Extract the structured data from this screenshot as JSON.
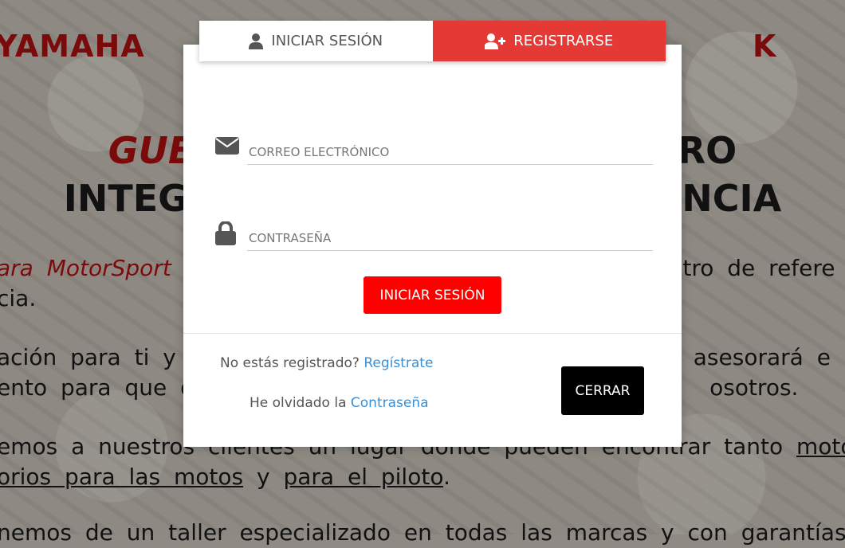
{
  "background": {
    "brands": {
      "yamaha": "YAMAHA",
      "k2": "K"
    },
    "hero": {
      "line1_red": "GUEV",
      "line1_end": "NTRO",
      "line2_start": "INTEGRA",
      "line2_end": "ALENCIA"
    },
    "paragraphs": {
      "p1_line1_red": "ara MotorSport",
      "p1_line1_end": "ntro de refere",
      "p1_line2": "cia.",
      "p2_line1_start": "ación para ti y",
      "p2_line1_end": "te asesorará e",
      "p2_line2_start": "ento para que dis",
      "p2_line2_end": "osotros.",
      "p3_line1_start": "emos a nuestros clientes un lugar donde pueden encontrar tanto",
      "p3_line1_link": "motos",
      "p3_line2_link1": "orios para las motos",
      "p3_line2_mid": "y",
      "p3_line2_link2": "para el piloto",
      "p3_line2_end": ".",
      "p4_line1": "nemos de un taller especializado en todas las marcas y con garantías o"
    }
  },
  "modal": {
    "tabs": {
      "login": "INICIAR SESIÓN",
      "register": "REGISTRARSE"
    },
    "email": {
      "placeholder": "CORREO ELECTRÓNICO",
      "value": ""
    },
    "password": {
      "placeholder": "CONTRASEÑA",
      "value": ""
    },
    "submit_label": "INICIAR SESIÓN",
    "not_registered_text": "No estás registrado?",
    "register_link": "Regístrate",
    "forgot_text": "He olvidado la",
    "forgot_link": "Contraseña",
    "close_label": "CERRAR"
  },
  "colors": {
    "register_tab": "#e53935",
    "submit_button": "#fe0000",
    "link": "#3a8fd4",
    "close_button": "#000000"
  }
}
